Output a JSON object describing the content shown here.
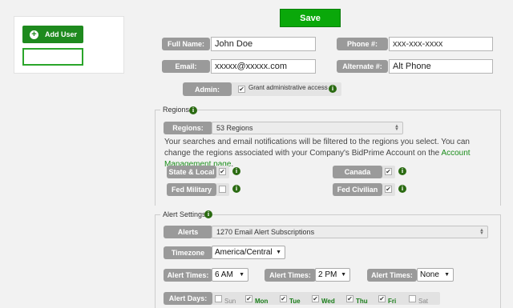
{
  "left_panel": {
    "add_user_label": "Add User"
  },
  "toolbar": {
    "save_label": "Save"
  },
  "user": {
    "full_name_label": "Full Name:",
    "full_name_value": "John Doe",
    "phone_label": "Phone #:",
    "phone_value": "xxx-xxx-xxxx",
    "email_label": "Email:",
    "email_value": "xxxxx@xxxxx.com",
    "alternate_label": "Alternate #:",
    "alternate_value": "Alt Phone",
    "admin_label": "Admin:",
    "admin_checkbox_label": "Grant administrative access",
    "admin_checked": true
  },
  "regions": {
    "legend": "Regions",
    "label": "Regions:",
    "selected": "53 Regions",
    "description_1": "Your searches and email notifications will be filtered to the regions you select. You can change the regions associated with your Company's BidPrime Account on the ",
    "description_link": "Account Management page",
    "description_2": ".",
    "categories": [
      {
        "label": "State & Local",
        "checked": true
      },
      {
        "label": "Canada",
        "checked": true
      },
      {
        "label": "Fed Military",
        "checked": false
      },
      {
        "label": "Fed Civilian",
        "checked": true
      }
    ]
  },
  "alerts": {
    "legend": "Alert Settings",
    "alerts_label": "Alerts",
    "alerts_selected": "1270 Email Alert Subscriptions",
    "timezone_label": "Timezone",
    "timezone_value": "America/Central",
    "alert_times_label": "Alert Times:",
    "alert_time_1": "6 AM",
    "alert_time_2": "2 PM",
    "alert_time_3": "None",
    "alert_days_label": "Alert Days:",
    "days": [
      {
        "label": "Sun",
        "checked": false
      },
      {
        "label": "Mon",
        "checked": true
      },
      {
        "label": "Tue",
        "checked": true
      },
      {
        "label": "Wed",
        "checked": true
      },
      {
        "label": "Thu",
        "checked": true
      },
      {
        "label": "Fri",
        "checked": true
      },
      {
        "label": "Sat",
        "checked": false
      }
    ]
  },
  "colors": {
    "accent": "#1e8a1e",
    "save": "#0aa80a",
    "label_gray": "#9a9a9a"
  }
}
